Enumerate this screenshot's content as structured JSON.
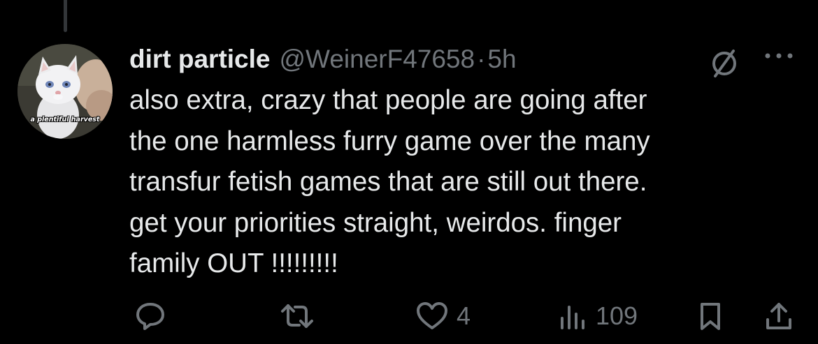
{
  "tweet": {
    "display_name": "dirt particle",
    "handle": "@WeinerF47658",
    "separator": "·",
    "timestamp": "5h",
    "avatar_caption": "a plentiful harvest",
    "text_lines": [
      "also extra, crazy that people are going after",
      "the one harmless furry game over the many",
      "transfur fetish games that are still out there.",
      "get your priorities straight, weirdos. finger",
      "family OUT !!!!!!!!!"
    ]
  },
  "actions": {
    "reply_count": "",
    "retweet_count": "",
    "like_count": "4",
    "view_count": "109"
  },
  "icons": {
    "header": [
      "grok-icon",
      "more-icon"
    ],
    "action_bar": [
      "reply-icon",
      "retweet-icon",
      "like-icon",
      "views-icon",
      "bookmark-icon",
      "share-icon"
    ]
  },
  "colors": {
    "background": "#000000",
    "text_primary": "#e7e9ea",
    "text_secondary": "#71767b",
    "thread_line": "#333639"
  }
}
